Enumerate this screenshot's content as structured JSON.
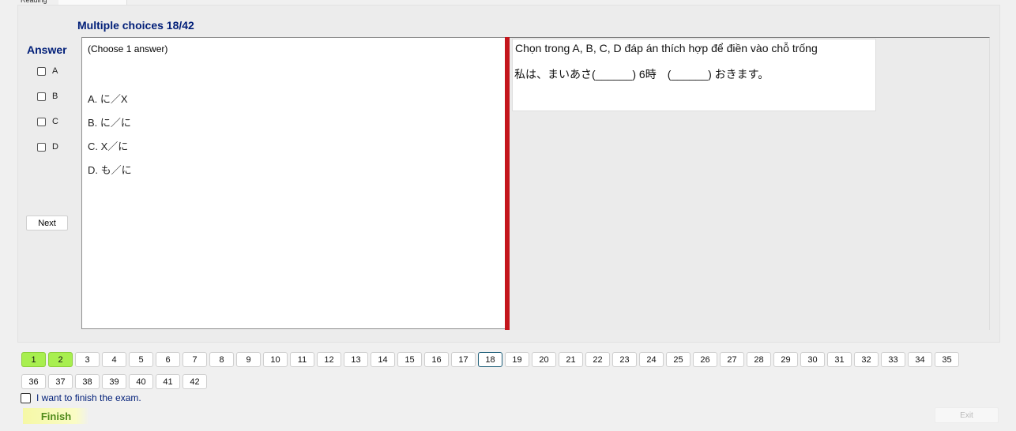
{
  "tabs": [
    "Reading",
    ""
  ],
  "title": "Multiple choices 18/42",
  "answer_panel": {
    "heading": "Answer",
    "options": [
      "A",
      "B",
      "C",
      "D"
    ],
    "next_label": "Next"
  },
  "question": {
    "instruction": "(Choose 1 answer)",
    "choices": [
      "A. に／X",
      "B. に／に",
      "C. X／に",
      "D. も／に"
    ]
  },
  "passage": {
    "line1": "Chọn trong A, B, C, D đáp án thích hợp để điền vào chỗ trống",
    "line2": "私は、まいあさ(______) 6時　(______) おきます。"
  },
  "navigation": {
    "current": 18,
    "answered": [
      1,
      2
    ],
    "row1": [
      "1",
      "2",
      "3",
      "4",
      "5",
      "6",
      "7",
      "8",
      "9",
      "10",
      "11",
      "12",
      "13",
      "14",
      "15",
      "16",
      "17",
      "18",
      "19",
      "20",
      "21",
      "22",
      "23",
      "24",
      "25",
      "26",
      "27",
      "28",
      "29",
      "30",
      "31",
      "32",
      "33",
      "34",
      "35"
    ],
    "row2": [
      "36",
      "37",
      "38",
      "39",
      "40",
      "41",
      "42"
    ]
  },
  "finish": {
    "checkbox_label": "I want to finish the exam.",
    "finish_label": "Finish",
    "exit_label": "Exit"
  },
  "colors": {
    "accent_blue": "#001e78",
    "splitter_red": "#c4161c",
    "answered_green": "#a8ef4f",
    "finish_yellow": "#f5f8a6"
  }
}
